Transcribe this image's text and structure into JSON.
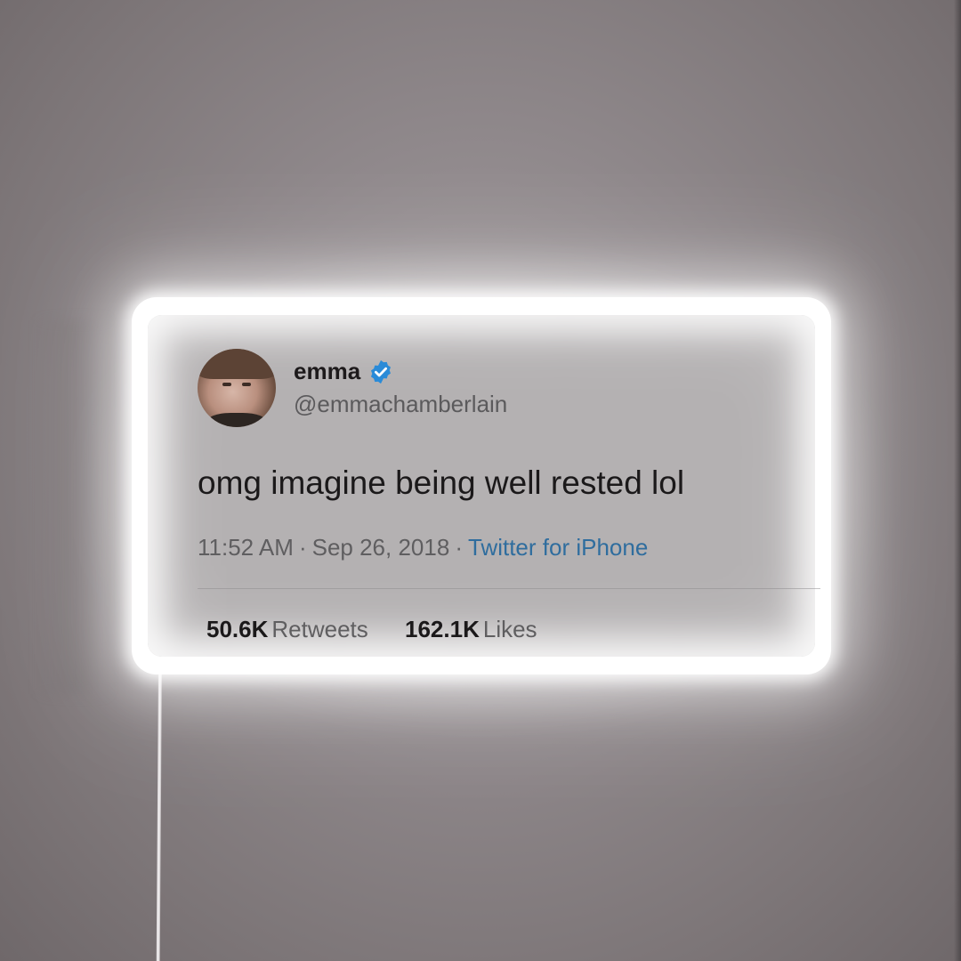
{
  "tweet": {
    "display_name": "emma",
    "handle": "@emmachamberlain",
    "text": "omg imagine being well rested lol",
    "time": "11:52 AM",
    "date": "Sep 26, 2018",
    "separator": "·",
    "source": "Twitter for iPhone",
    "retweets_count": "50.6K",
    "retweets_label": "Retweets",
    "likes_count": "162.1K",
    "likes_label": "Likes"
  },
  "icons": {
    "verified": "verified-badge-icon",
    "avatar": "profile-photo"
  },
  "colors": {
    "verified_blue": "#2a8bd8",
    "link_blue": "#2f6d9e",
    "neon_white": "#ffffff"
  }
}
